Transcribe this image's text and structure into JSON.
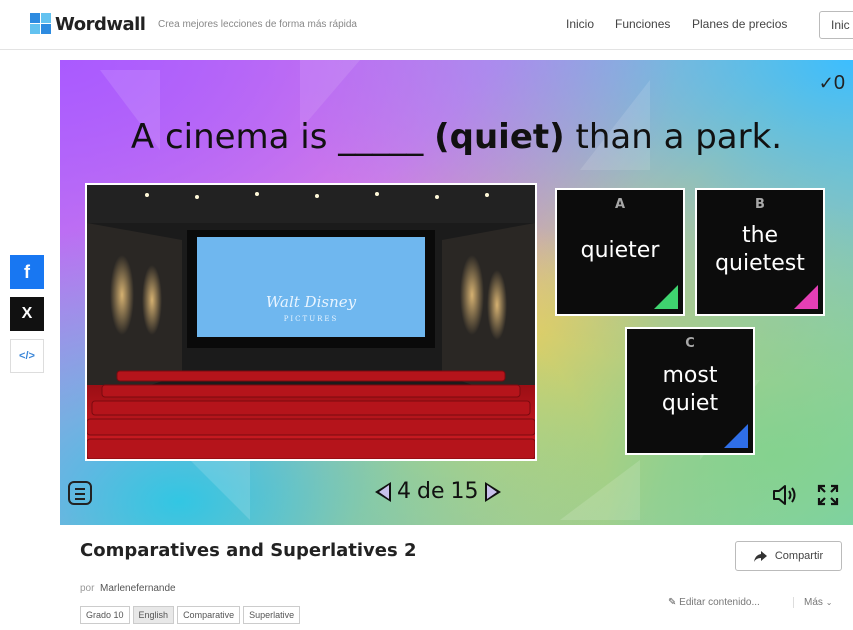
{
  "header": {
    "logo_text": "Wordwall",
    "tagline": "Crea mejores lecciones de forma más rápida",
    "nav": [
      "Inicio",
      "Funciones",
      "Planes de precios"
    ],
    "login_label": "Inic"
  },
  "share_sidebar": {
    "facebook_label": "f",
    "x_label": "X",
    "embed_label": "</>",
    "facebook_color": "#1877f2",
    "x_color": "#111111"
  },
  "game": {
    "score": "0",
    "question_before": "A cinema is _____ ",
    "question_bold": "(quiet)",
    "question_after": " than a park.",
    "image_screen_text": "Walt Disney",
    "image_screen_subtext": "PICTURES",
    "answers": [
      {
        "letter": "A",
        "text": "quieter",
        "corner_color": "#3fd46f"
      },
      {
        "letter": "B",
        "text": "the quietest",
        "corner_color": "#e43fb5"
      },
      {
        "letter": "C",
        "text": "most quiet",
        "corner_color": "#2f6fe8"
      }
    ],
    "pager": {
      "current": "4",
      "separator": "de",
      "total": "15"
    }
  },
  "activity": {
    "title": "Comparatives and Superlatives 2",
    "author_prefix": "por",
    "author": "Marlenefernande",
    "tags": [
      "Grado 10",
      "English",
      "Comparative",
      "Superlative"
    ],
    "share_label": "Compartir",
    "edit_label": "Editar contenido...",
    "more_label": "Más"
  }
}
